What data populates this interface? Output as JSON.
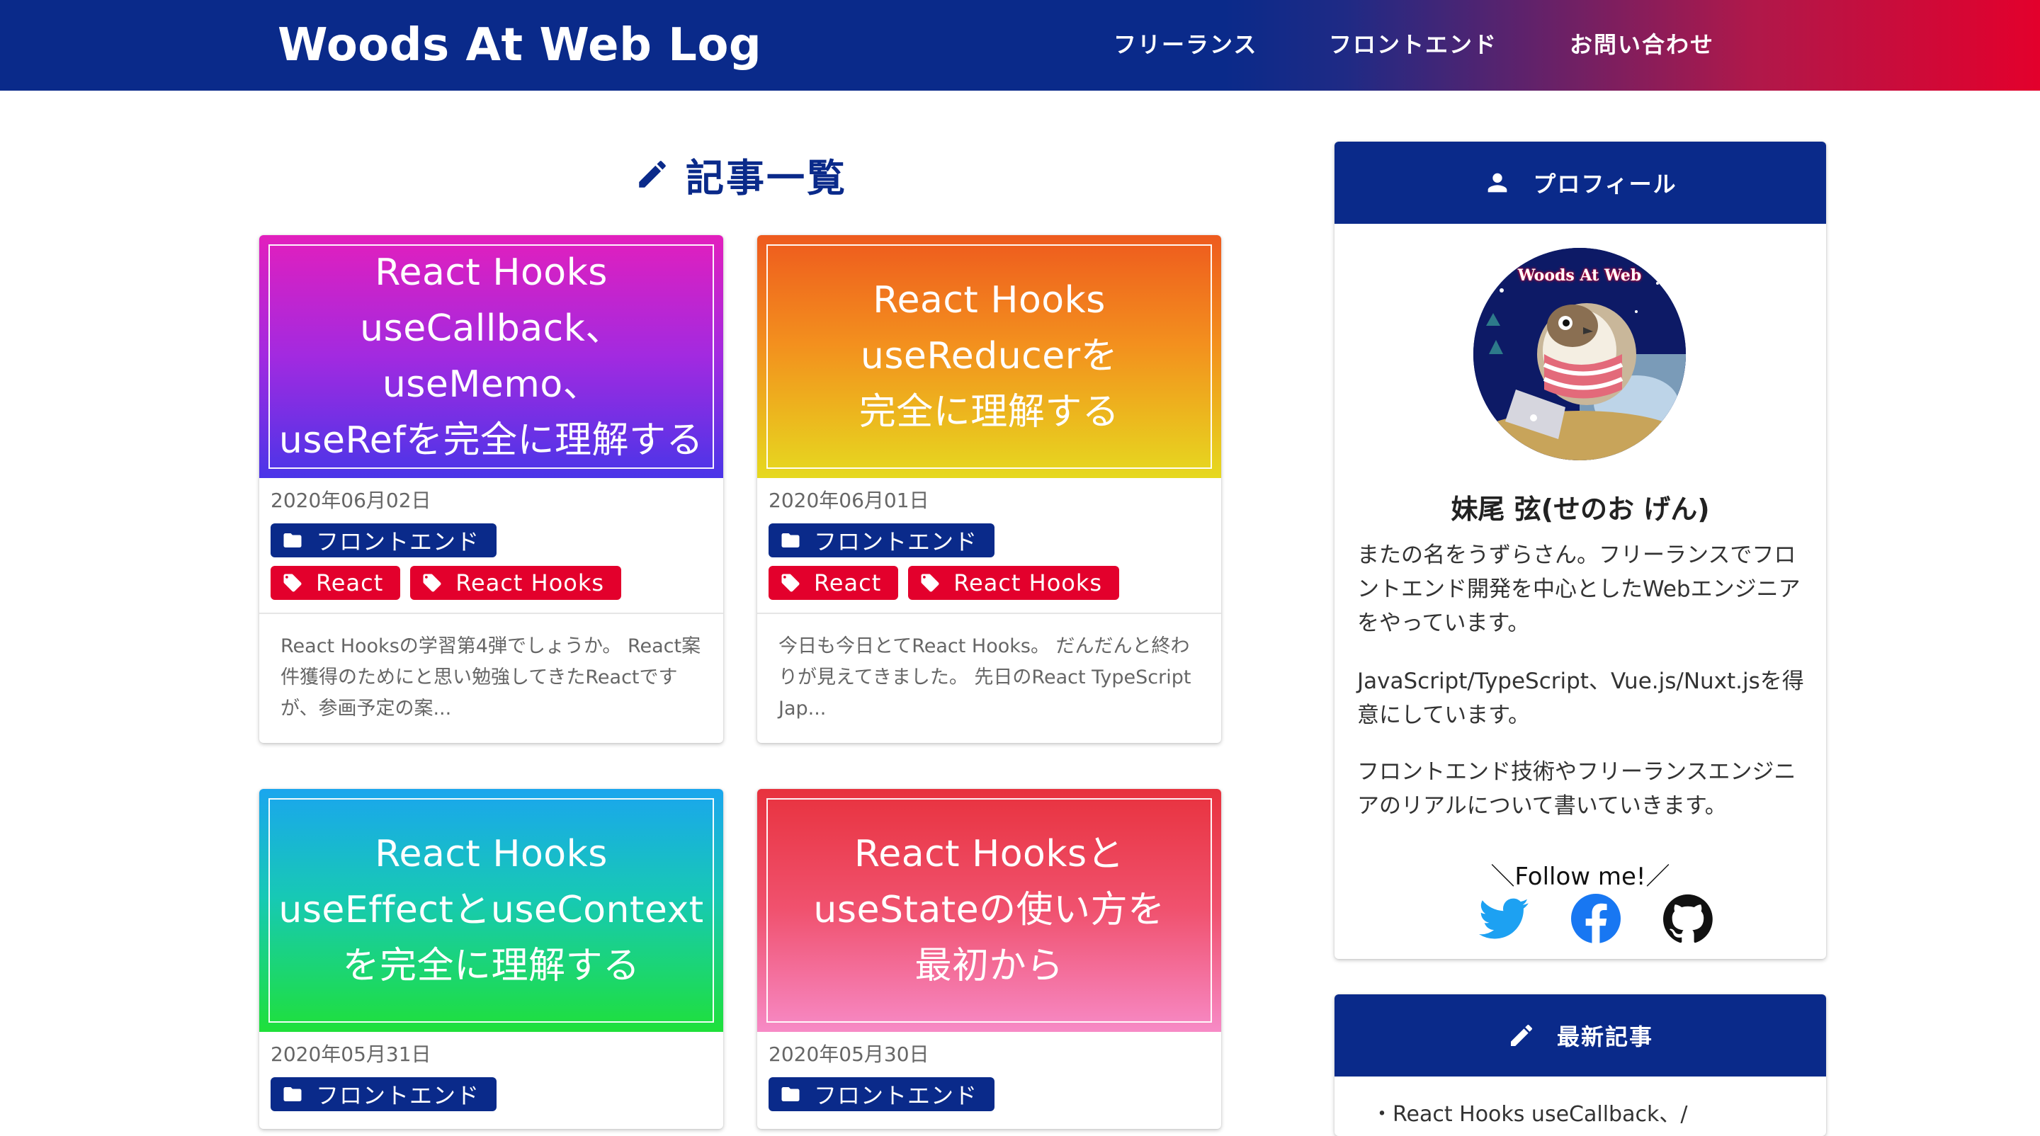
{
  "header": {
    "site_title": "Woods At Web Log",
    "nav": [
      "フリーランス",
      "フロントエンド",
      "お問い合わせ"
    ]
  },
  "main": {
    "heading": "記事一覧",
    "heading_icon": "pencil-icon",
    "posts": [
      {
        "thumb_text": "React Hooks\nuseCallback、useMemo、\nuseRefを完全に理解する",
        "date": "2020年06月02日",
        "category": "フロントエンド",
        "tags": [
          "React",
          "React Hooks"
        ],
        "excerpt": "React Hooksの学習第4弾でしょうか。 React案件獲得のためにと思い勉強してきたReactですが、参画予定の案..."
      },
      {
        "thumb_text": "React Hooks\nuseReducerを\n完全に理解する",
        "date": "2020年06月01日",
        "category": "フロントエンド",
        "tags": [
          "React",
          "React Hooks"
        ],
        "excerpt": "今日も今日とてReact Hooks。 だんだんと終わりが見えてきました。 先日のReact TypeScript Jap..."
      },
      {
        "thumb_text": "React Hooks\nuseEffectとuseContext\nを完全に理解する",
        "date": "2020年05月31日",
        "category": "フロントエンド",
        "tags": [],
        "excerpt": ""
      },
      {
        "thumb_text": "React Hooksと\nuseStateの使い方を\n最初から",
        "date": "2020年05月30日",
        "category": "フロントエンド",
        "tags": [],
        "excerpt": ""
      }
    ]
  },
  "sidebar": {
    "profile": {
      "title": "プロフィール",
      "title_icon": "person-icon",
      "avatar_text": "Woods At Web",
      "name": "妹尾 弦(せのお げん)",
      "bio": [
        "またの名をうずらさん。フリーランスでフロントエンド開発を中心としたWebエンジニアをやっています。",
        "JavaScript/TypeScript、Vue.js/Nuxt.jsを得意にしています。",
        "フロントエンド技術やフリーランスエンジニアのリアルについて書いていきます。"
      ],
      "follow_label": "＼Follow me!／",
      "social": [
        "twitter-icon",
        "facebook-icon",
        "github-icon"
      ]
    },
    "recent": {
      "title": "最新記事",
      "title_icon": "pencil-icon",
      "first_item": "・React Hooks useCallback、/"
    }
  },
  "colors": {
    "navy": "#0a2a8a",
    "red": "#e3002c",
    "twitter": "#1da1f2",
    "facebook": "#1877f2"
  }
}
